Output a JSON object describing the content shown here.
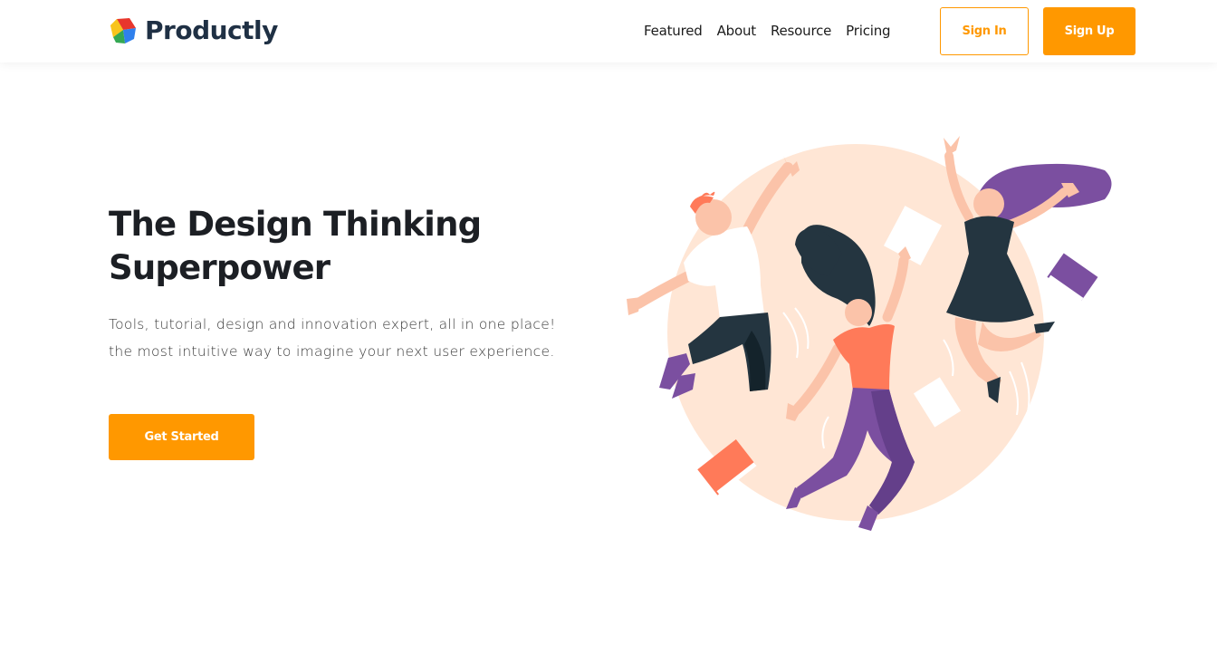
{
  "brand": {
    "name": "Productly",
    "logo_icon": "colorful-hexagon-logo"
  },
  "nav": {
    "links": [
      "Featured",
      "About",
      "Resource",
      "Pricing"
    ],
    "sign_in": "Sign In",
    "sign_up": "Sign Up"
  },
  "hero": {
    "title_line1": "The Design Thinking",
    "title_line2": "Superpower",
    "description": "Tools, tutorial, design and innovation expert, all in one place! the most intuitive way to imagine your next user experience.",
    "cta": "Get Started",
    "illustration": "three-people-jumping-illustration"
  },
  "colors": {
    "accent": "#ff9800",
    "heading": "#1c1f24",
    "brand_text": "#1f3044",
    "circle_bg": "#ffe6d5",
    "purple": "#7b4fa0",
    "coral": "#ff7a59",
    "dark": "#243540"
  }
}
